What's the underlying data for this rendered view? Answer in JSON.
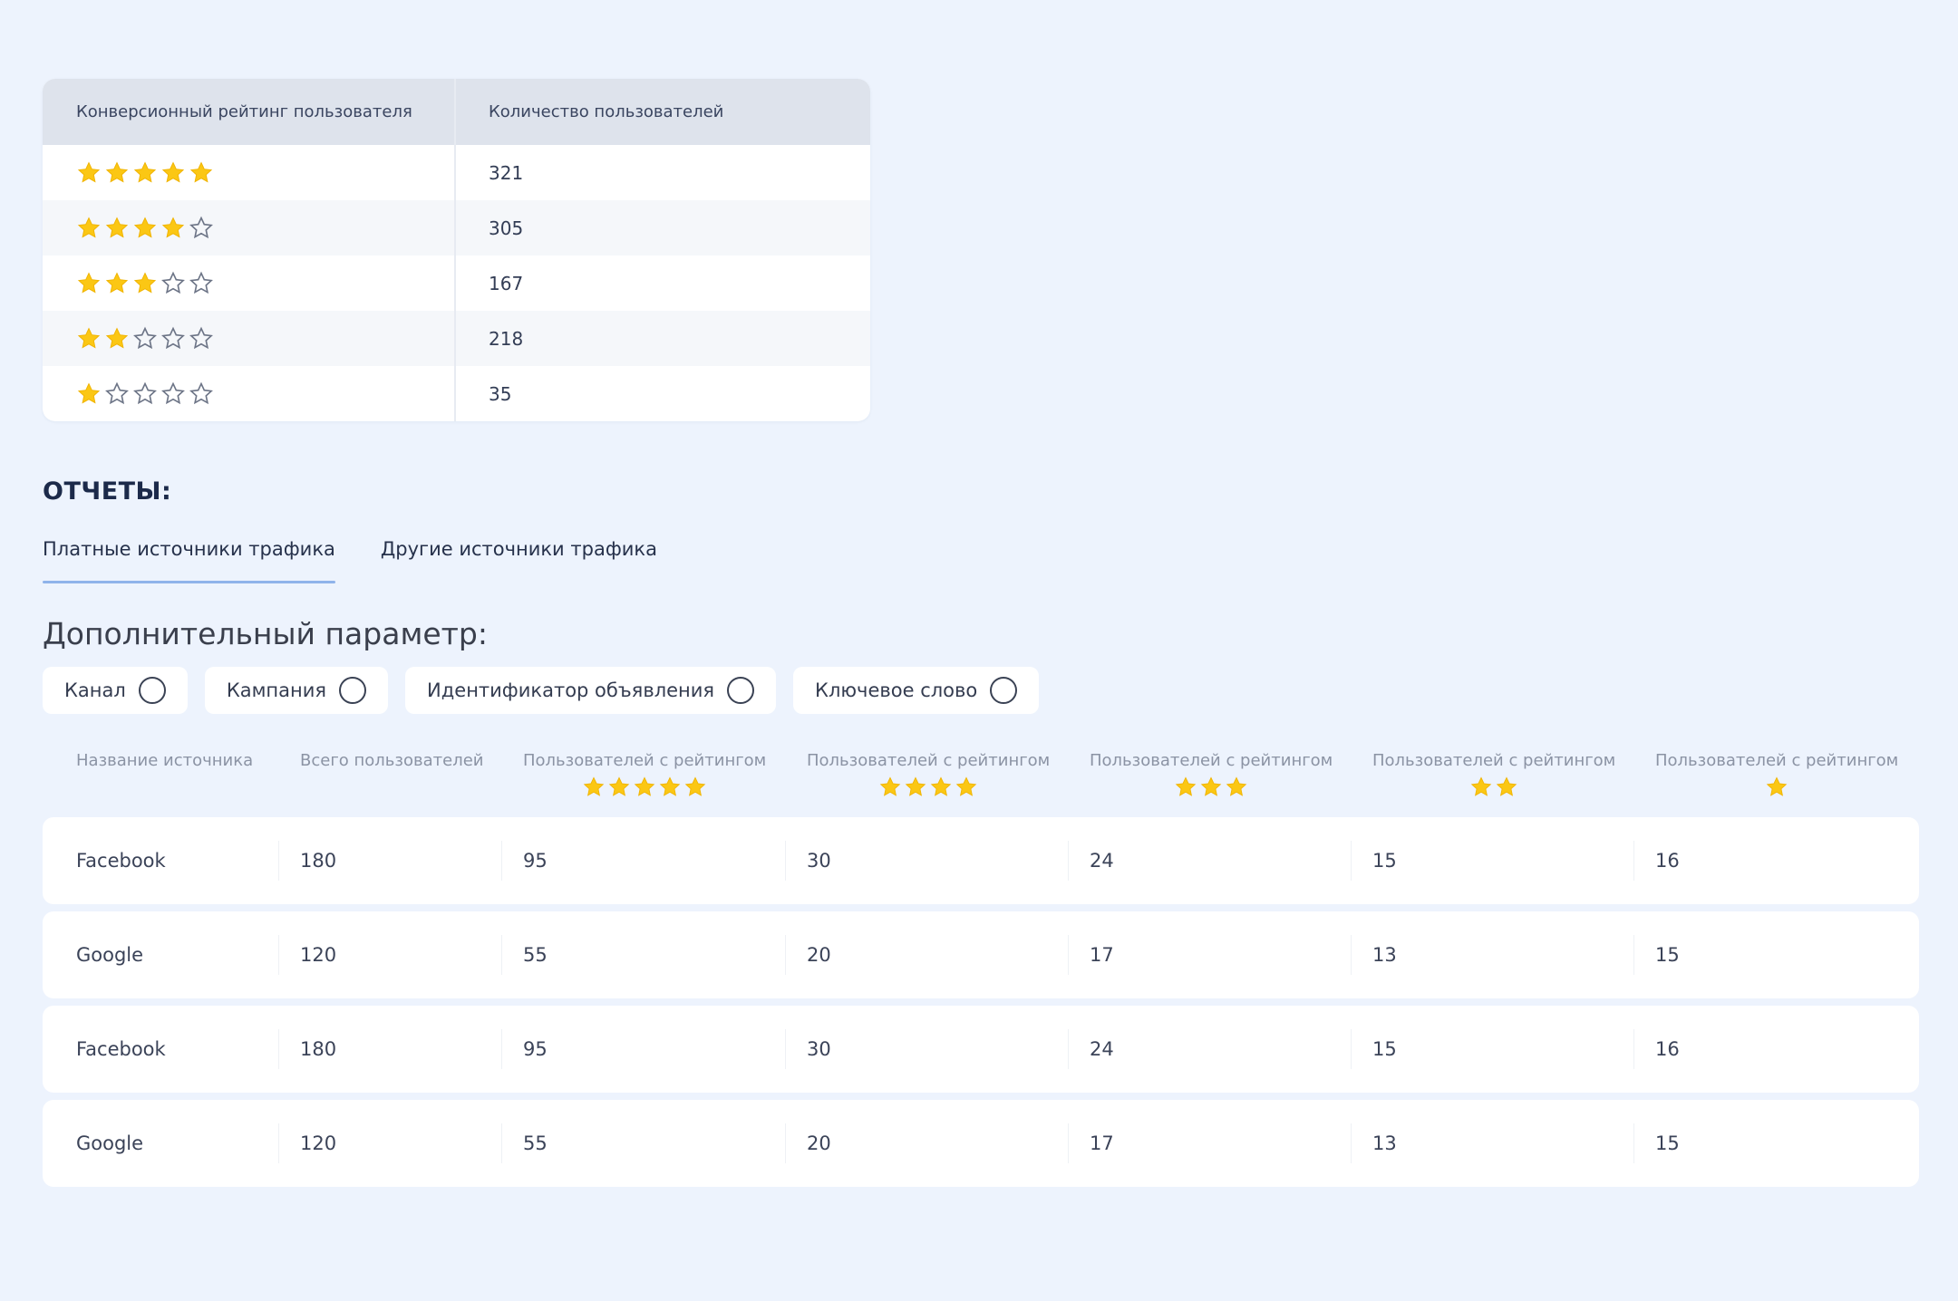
{
  "rating_table": {
    "headers": [
      "Конверсионный рейтинг пользователя",
      "Количество пользователей"
    ],
    "rows": [
      {
        "stars": 5,
        "count": "321"
      },
      {
        "stars": 4,
        "count": "305"
      },
      {
        "stars": 3,
        "count": "167"
      },
      {
        "stars": 2,
        "count": "218"
      },
      {
        "stars": 1,
        "count": "35"
      }
    ],
    "star_colors": {
      "full": "#fbc714",
      "empty": "#6c7486"
    }
  },
  "reports": {
    "title": "ОТЧЕТЫ:",
    "tabs": [
      {
        "label": "Платные источники трафика",
        "active": true
      },
      {
        "label": "Другие источники трафика",
        "active": false
      }
    ],
    "accent_color": "#8fb3ea"
  },
  "params": {
    "title": "Дополнительный параметр:",
    "options": [
      {
        "label": "Канал",
        "checked": false
      },
      {
        "label": "Кампания",
        "checked": false
      },
      {
        "label": "Идентификатор объявления",
        "checked": false
      },
      {
        "label": "Ключевое слово",
        "checked": false
      }
    ]
  },
  "sources": {
    "headers": [
      {
        "label": "Название источника",
        "stars": 0
      },
      {
        "label": "Всего пользователей",
        "stars": 0
      },
      {
        "label": "Пользователей с рейтингом",
        "stars": 5
      },
      {
        "label": "Пользователей с рейтингом",
        "stars": 4
      },
      {
        "label": "Пользователей с рейтингом",
        "stars": 3
      },
      {
        "label": "Пользователей с рейтингом",
        "stars": 2
      },
      {
        "label": "Пользователей с рейтингом",
        "stars": 1
      }
    ],
    "rows": [
      [
        "Facebook",
        "180",
        "95",
        "30",
        "24",
        "15",
        "16"
      ],
      [
        "Google",
        "120",
        "55",
        "20",
        "17",
        "13",
        "15"
      ],
      [
        "Facebook",
        "180",
        "95",
        "30",
        "24",
        "15",
        "16"
      ],
      [
        "Google",
        "120",
        "55",
        "20",
        "17",
        "13",
        "15"
      ]
    ]
  }
}
